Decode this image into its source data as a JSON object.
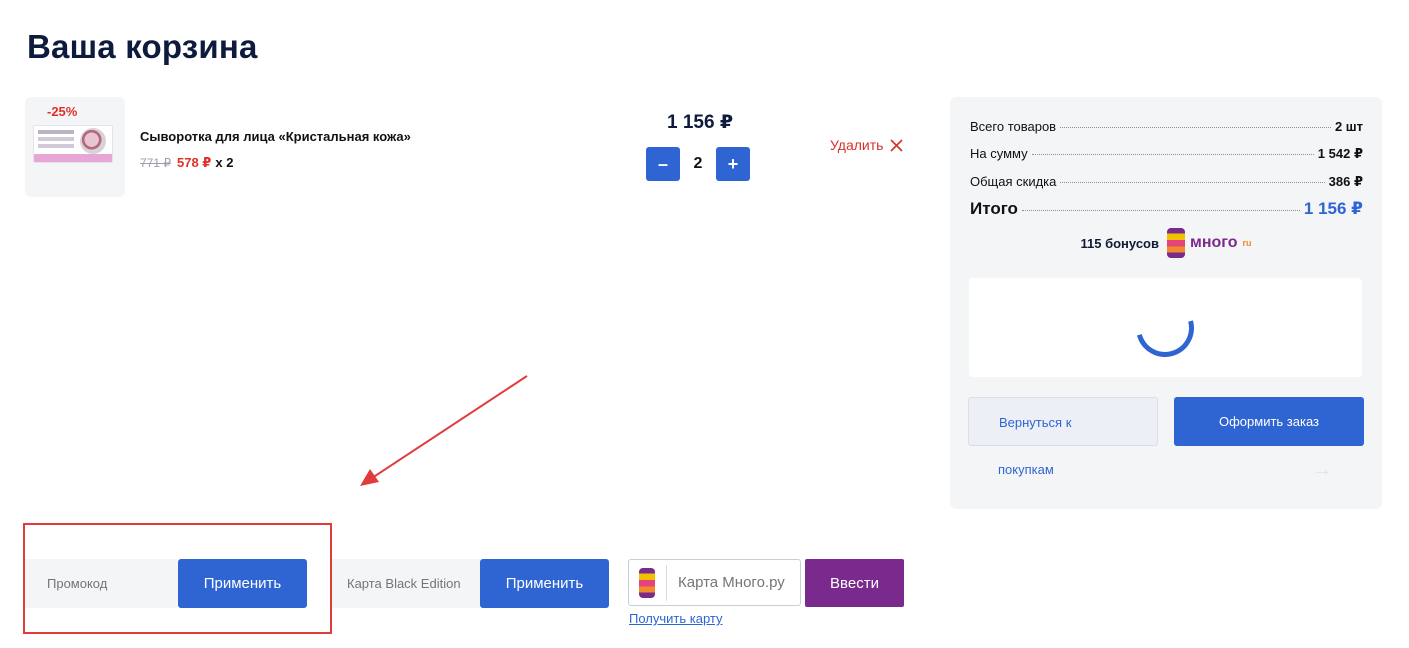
{
  "page": {
    "title": "Ваша корзина"
  },
  "cart_item": {
    "discount_badge": "-25%",
    "name": "Сыворотка для лица «Кристальная кожа»",
    "old_price": "771 ₽",
    "new_price": "578 ₽",
    "multiplier": "x 2",
    "line_total": "1 156 ₽",
    "quantity": "2",
    "minus_label": "–",
    "plus_label": "+",
    "remove_label": "Удалить"
  },
  "summary": {
    "rows": [
      {
        "label": "Всего товаров",
        "value": "2 шт"
      },
      {
        "label": "На сумму",
        "value": "1 542 ₽"
      },
      {
        "label": "Общая скидка",
        "value": "386 ₽"
      },
      {
        "label": "Итого",
        "value": "1 156 ₽"
      }
    ],
    "bonus_text": "115 бонусов",
    "mnogo_logo_text": "много",
    "mnogo_logo_suffix": "ru",
    "back_button_label": "Вернуться к",
    "back_button_label_tail": "покупкам",
    "order_button_label": "Оформить заказ"
  },
  "forms": {
    "promo_placeholder": "Промокод",
    "promo_button": "Применить",
    "black_placeholder": "Карта Black Edition",
    "black_button": "Применить",
    "mnogo_placeholder": "Карта Много.ру",
    "mnogo_button": "Ввести",
    "get_card_link": "Получить карту"
  },
  "colors": {
    "accent": "#2f64d3",
    "danger": "#e0302b",
    "mnogo": "#7a2a8c",
    "annotation": "#e23b3b"
  },
  "icons": {
    "remove": "close-icon",
    "loading": "spinner-icon",
    "arrow": "arrow-right-icon"
  }
}
